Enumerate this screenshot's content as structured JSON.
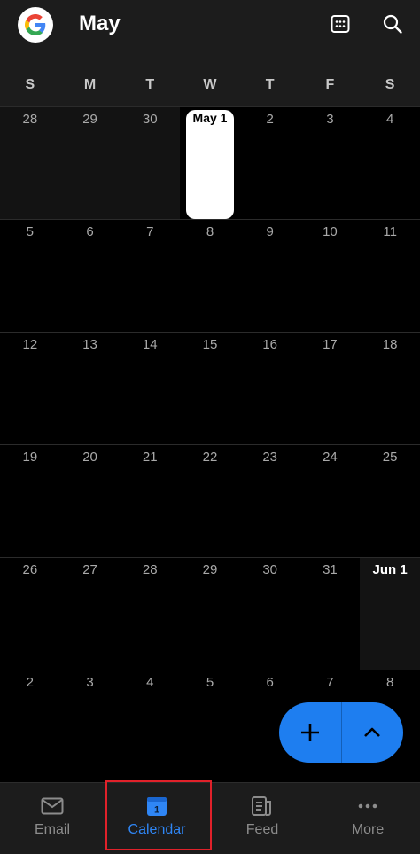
{
  "header": {
    "month": "May",
    "avatar_icon": "google-g-icon",
    "day_view_icon": "calendar-grid-icon",
    "search_icon": "search-icon"
  },
  "weekdays": [
    "S",
    "M",
    "T",
    "W",
    "T",
    "F",
    "S"
  ],
  "weeks": [
    [
      {
        "label": "28",
        "style": "other"
      },
      {
        "label": "29",
        "style": "other"
      },
      {
        "label": "30",
        "style": "other"
      },
      {
        "label": "May 1",
        "style": "today"
      },
      {
        "label": "2",
        "style": ""
      },
      {
        "label": "3",
        "style": ""
      },
      {
        "label": "4",
        "style": ""
      }
    ],
    [
      {
        "label": "5",
        "style": ""
      },
      {
        "label": "6",
        "style": ""
      },
      {
        "label": "7",
        "style": ""
      },
      {
        "label": "8",
        "style": ""
      },
      {
        "label": "9",
        "style": ""
      },
      {
        "label": "10",
        "style": ""
      },
      {
        "label": "11",
        "style": ""
      }
    ],
    [
      {
        "label": "12",
        "style": ""
      },
      {
        "label": "13",
        "style": ""
      },
      {
        "label": "14",
        "style": ""
      },
      {
        "label": "15",
        "style": ""
      },
      {
        "label": "16",
        "style": ""
      },
      {
        "label": "17",
        "style": ""
      },
      {
        "label": "18",
        "style": ""
      }
    ],
    [
      {
        "label": "19",
        "style": ""
      },
      {
        "label": "20",
        "style": ""
      },
      {
        "label": "21",
        "style": ""
      },
      {
        "label": "22",
        "style": ""
      },
      {
        "label": "23",
        "style": ""
      },
      {
        "label": "24",
        "style": ""
      },
      {
        "label": "25",
        "style": ""
      }
    ],
    [
      {
        "label": "26",
        "style": ""
      },
      {
        "label": "27",
        "style": ""
      },
      {
        "label": "28",
        "style": ""
      },
      {
        "label": "29",
        "style": ""
      },
      {
        "label": "30",
        "style": ""
      },
      {
        "label": "31",
        "style": ""
      },
      {
        "label": "Jun 1",
        "style": "other-bold"
      }
    ],
    [
      {
        "label": "2",
        "style": "other"
      },
      {
        "label": "3",
        "style": "other"
      },
      {
        "label": "4",
        "style": "other"
      },
      {
        "label": "5",
        "style": "other"
      },
      {
        "label": "6",
        "style": "other"
      },
      {
        "label": "7",
        "style": "other"
      },
      {
        "label": "8",
        "style": "other"
      }
    ]
  ],
  "fab": {
    "add_icon": "plus-icon",
    "expand_icon": "chevron-up-icon"
  },
  "nav": {
    "items": [
      {
        "label": "Email",
        "icon": "mail-icon",
        "active": false
      },
      {
        "label": "Calendar",
        "icon": "calendar-icon",
        "active": true,
        "badge": "1"
      },
      {
        "label": "Feed",
        "icon": "feed-icon",
        "active": false
      },
      {
        "label": "More",
        "icon": "more-dots-icon",
        "active": false
      }
    ]
  },
  "colors": {
    "accent": "#1e7ef0",
    "active_nav": "#2f86f5",
    "highlight_box": "#e0212a",
    "background": "#000000",
    "bar": "#1c1c1c"
  }
}
